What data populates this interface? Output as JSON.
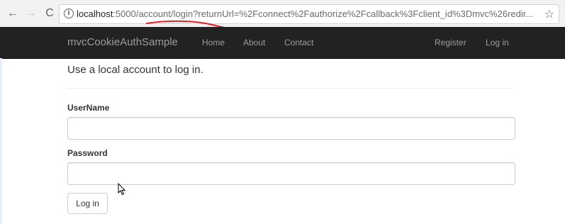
{
  "browser": {
    "url_host": "localhost",
    "url_rest": ":5000/account/login?returnUrl=%2Fconnect%2Fauthorize%2Fcallback%3Fclient_id%3Dmvc%26redir...",
    "info_glyph": "i",
    "back_glyph": "←",
    "forward_glyph": "→",
    "reload_glyph": "C",
    "star_glyph": "☆"
  },
  "navbar": {
    "brand": "mvcCookieAuthSample",
    "links": [
      "Home",
      "About",
      "Contact"
    ],
    "right_links": [
      "Register",
      "Log in"
    ]
  },
  "form": {
    "lead": "Use a local account to log in.",
    "username_label": "UserName",
    "username_value": "",
    "password_label": "Password",
    "password_value": "",
    "submit_label": "Log in"
  },
  "colors": {
    "navbar_bg": "#222222",
    "nav_text": "#9d9d9d",
    "annotation_red": "#e02020"
  }
}
